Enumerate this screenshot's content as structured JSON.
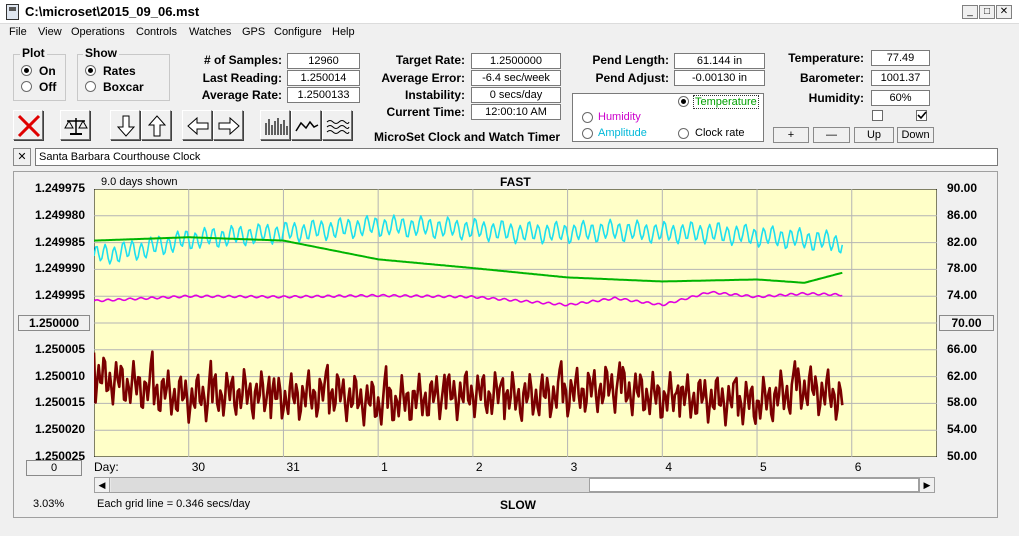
{
  "window": {
    "title": "C:\\microset\\2015_09_06.mst",
    "buttons": {
      "minimize": "_",
      "maximize": "□",
      "close": "✕"
    }
  },
  "menu": [
    "File",
    "View",
    "Operations",
    "Controls",
    "Watches",
    "GPS",
    "Configure",
    "Help"
  ],
  "plot_group": {
    "title": "Plot",
    "options": [
      "On",
      "Off"
    ],
    "selected": "On"
  },
  "show_group": {
    "title": "Show",
    "options": [
      "Rates",
      "Boxcar"
    ],
    "selected": "Rates"
  },
  "stats": {
    "samples_label": "# of Samples:",
    "samples": "12960",
    "last_label": "Last Reading:",
    "last": "1.250014",
    "avg_rate_label": "Average Rate:",
    "avg_rate": "1.2500133",
    "target_label": "Target Rate:",
    "target": "1.2500000",
    "avg_err_label": "Average Error:",
    "avg_err": "-6.4 sec/week",
    "instab_label": "Instability:",
    "instab": "0 secs/day",
    "time_label": "Current Time:",
    "time": "12:00:10 AM",
    "pend_len_label": "Pend Length:",
    "pend_len": "61.144 in",
    "pend_adj_label": "Pend Adjust:",
    "pend_adj": "-0.00130 in",
    "temp_label": "Temperature:",
    "temp": "77.49",
    "baro_label": "Barometer:",
    "baro": "1001.37",
    "hum_label": "Humidity:",
    "hum": "60%"
  },
  "app_caption": "MicroSet Clock and Watch Timer",
  "series_select": {
    "temperature": "Temperature",
    "humidity": "Humidity",
    "amplitude": "Amplitude",
    "clock_rate": "Clock rate",
    "selected": "Temperature",
    "colors": {
      "temperature": "#00a000",
      "humidity": "#cc00cc",
      "amplitude": "#00b8d8",
      "clock_rate": "#000000"
    }
  },
  "scale_buttons": [
    "+",
    "—",
    "Up",
    "Down"
  ],
  "clock_name": "Santa Barbara Courthouse Clock",
  "chart": {
    "top_left_note": "9.0 days shown",
    "top_label": "FAST",
    "bottom_label": "SLOW",
    "grid_note": "Each grid line = 0.346 secs/day",
    "percent": "3.03%",
    "day_label": "Day:",
    "left_ticks": [
      "1.249975",
      "1.249980",
      "1.249985",
      "1.249990",
      "1.249995",
      "1.250000",
      "1.250005",
      "1.250010",
      "1.250015",
      "1.250020",
      "1.250025"
    ],
    "right_ticks": [
      "90.00",
      "86.00",
      "82.00",
      "78.00",
      "74.00",
      "70.00",
      "66.00",
      "62.00",
      "58.00",
      "54.00",
      "50.00"
    ],
    "left_center_button": "1.250000",
    "right_center_button": "70.00",
    "left_bottom_button": "0",
    "days": [
      "30",
      "31",
      "1",
      "2",
      "3",
      "4",
      "5",
      "6"
    ],
    "colors": {
      "background": "#ffffc8",
      "grid": "#b4b4b4",
      "rate": "#7a0000",
      "temperature": "#00b400",
      "humidity": "#e000e0",
      "amplitude": "#1ee0f0"
    }
  },
  "chart_data": {
    "type": "line",
    "x_unit": "days",
    "x_range": [
      -1.0,
      7.9
    ],
    "y_left_range": [
      1.249975,
      1.250025
    ],
    "y_left_inverted": true,
    "y_right_range": [
      50,
      90
    ],
    "series": [
      {
        "name": "Clock rate",
        "axis": "left",
        "x": [
          -1.0,
          -0.5,
          0.0,
          0.5,
          1.0,
          1.5,
          2.0,
          2.5,
          3.0,
          3.5,
          4.0,
          4.5,
          5.0,
          5.5,
          6.0,
          6.5,
          6.9
        ],
        "y": [
          1.25001,
          1.250012,
          1.250014,
          1.250013,
          1.250014,
          1.250013,
          1.250015,
          1.250014,
          1.250013,
          1.250014,
          1.250013,
          1.250012,
          1.250014,
          1.250014,
          1.250015,
          1.250012,
          1.250014
        ]
      },
      {
        "name": "Temperature",
        "axis": "right",
        "x": [
          -1.0,
          0.0,
          1.0,
          2.0,
          3.0,
          4.0,
          5.0,
          6.0,
          6.5,
          6.9
        ],
        "y": [
          82.3,
          82.8,
          82.3,
          79.5,
          78.2,
          76.8,
          76.2,
          76.5,
          76.0,
          77.5
        ]
      },
      {
        "name": "Humidity",
        "axis": "right",
        "x": [
          -1.0,
          0.0,
          1.0,
          2.0,
          3.0,
          4.0,
          4.5,
          5.0,
          5.5,
          6.0,
          6.5,
          6.9
        ],
        "y": [
          73.3,
          74.0,
          73.9,
          74.1,
          73.9,
          72.7,
          73.7,
          72.7,
          74.6,
          73.9,
          74.4,
          74.2
        ]
      },
      {
        "name": "Amplitude",
        "axis": "right",
        "x": [
          -1.0,
          -0.5,
          0.0,
          0.5,
          1.0,
          1.5,
          2.0,
          2.5,
          3.0,
          3.5,
          4.0,
          4.5,
          5.0,
          5.5,
          6.0,
          6.5,
          6.9
        ],
        "y": [
          80.0,
          81.0,
          82.5,
          83.0,
          83.5,
          84.0,
          84.5,
          84.3,
          84.0,
          83.5,
          83.5,
          83.8,
          83.5,
          83.5,
          83.0,
          82.5,
          82.0
        ]
      }
    ]
  }
}
